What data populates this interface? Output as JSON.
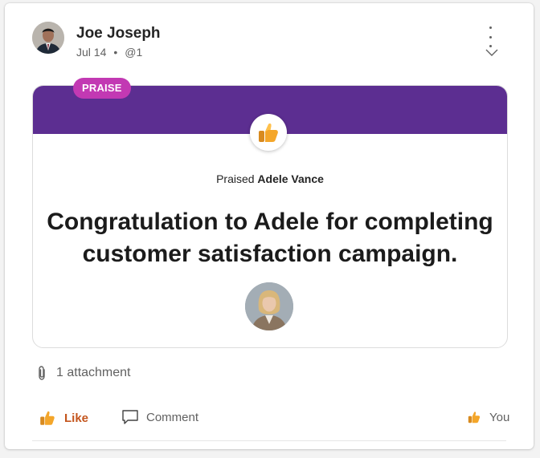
{
  "post": {
    "author_name": "Joe Joseph",
    "date": "Jul 14",
    "separator": "•",
    "mention": "@1",
    "more_icon": "more-vertical-icon",
    "expand_icon": "chevron-down-icon"
  },
  "praise": {
    "badge": "PRAISE",
    "icon": "thumbs-up-icon",
    "praised_prefix": "Praised",
    "recipient": "Adele Vance",
    "message_line1": "Congratulation to Adele for completing",
    "message_line2": "customer satisfaction campaign.",
    "banner_color": "#5c2e91",
    "badge_color": "#c239b3"
  },
  "attachments": {
    "icon": "paperclip-icon",
    "label": "1 attachment"
  },
  "actions": {
    "like_label": "Like",
    "comment_label": "Comment",
    "reaction_by": "You",
    "like_color": "#c4551d"
  }
}
